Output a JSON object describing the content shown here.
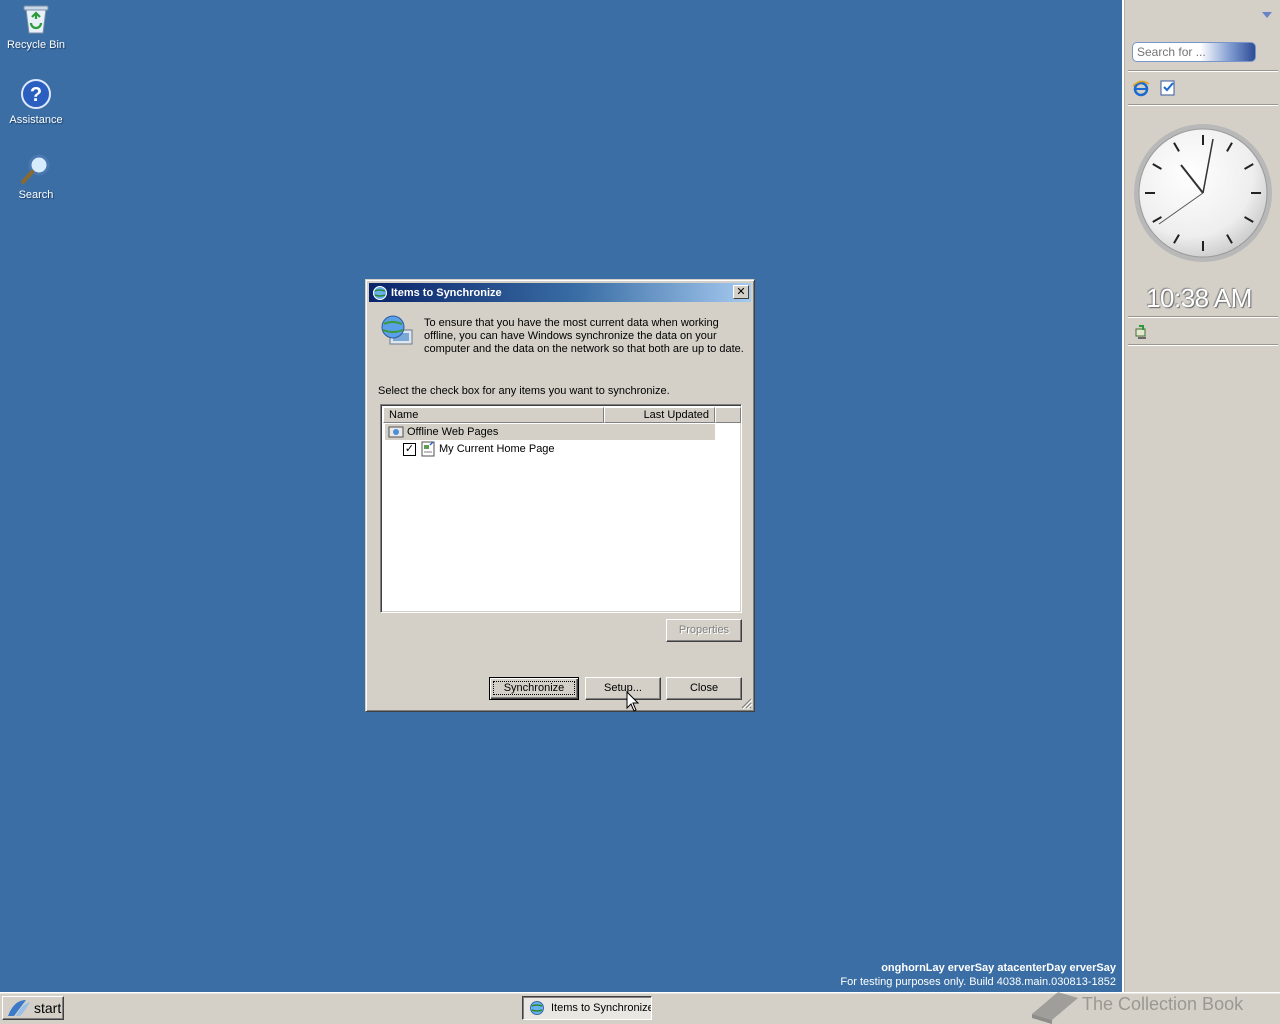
{
  "desktop": {
    "icons": [
      {
        "label": "Recycle Bin",
        "icon": "recycle-bin-icon"
      },
      {
        "label": "Assistance",
        "icon": "help-icon"
      },
      {
        "label": "Search",
        "icon": "search-icon"
      }
    ]
  },
  "sidebar": {
    "search_placeholder": "Search for ...",
    "clock_time": "10:38 AM"
  },
  "dialog": {
    "title": "Items to Synchronize",
    "close_label": "✕",
    "intro": "To ensure that you have the most current data when working offline, you can have Windows synchronize the data on your computer and the data on the network so that both are up to date.",
    "instruction": "Select the check box for any items you want to synchronize.",
    "columns": {
      "name": "Name",
      "last_updated": "Last Updated"
    },
    "group": {
      "label": "Offline Web Pages",
      "icon": "offline-pages-icon"
    },
    "items": [
      {
        "label": "My Current Home Page",
        "checked": true,
        "icon": "web-page-icon"
      }
    ],
    "buttons": {
      "properties": "Properties",
      "synchronize": "Synchronize",
      "setup": "Setup...",
      "close": "Close"
    }
  },
  "watermark": {
    "line1": "onghornLay erverSay atacenterDay erverSay",
    "line2": "For testing purposes only. Build 4038.main.030813-1852"
  },
  "overlay": {
    "collection_text": "The Collection Book"
  },
  "taskbar": {
    "start_label": "start",
    "task_label": "Items to Synchronize"
  },
  "colors": {
    "desktop": "#3a6ea5",
    "titlebar_start": "#0a246a",
    "titlebar_end": "#a6caf0",
    "face": "#d4d0c8"
  }
}
